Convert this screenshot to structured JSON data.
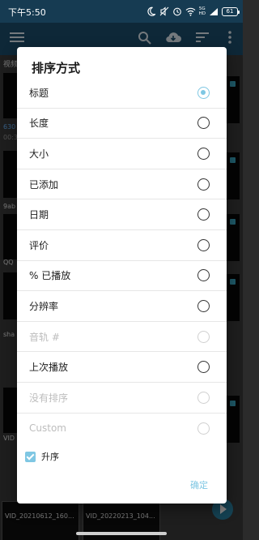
{
  "status_bar": {
    "time": "下午5:50",
    "network": "5G",
    "network_sub": "HD",
    "battery": "61"
  },
  "app_bar": {
    "icons": [
      "menu-icon",
      "search-icon",
      "cloud-download-icon",
      "sort-icon",
      "more-vert-icon"
    ]
  },
  "background": {
    "header": "视频",
    "items": [
      {
        "label": "630",
        "style": "blue"
      },
      {
        "label": "00:3",
        "style": "dim"
      },
      {
        "label": "9ab",
        "style": "normal"
      },
      {
        "label": "QQ",
        "style": "normal"
      },
      {
        "label": "sha",
        "style": "normal"
      },
      {
        "label": "VID",
        "style": "normal"
      }
    ],
    "bottom_captions": [
      "VID_20210612_160...",
      "VID_20220213_104..."
    ]
  },
  "dialog": {
    "title": "排序方式",
    "options": [
      {
        "label": "标题",
        "checked": true,
        "enabled": true
      },
      {
        "label": "长度",
        "checked": false,
        "enabled": true
      },
      {
        "label": "大小",
        "checked": false,
        "enabled": true
      },
      {
        "label": "已添加",
        "checked": false,
        "enabled": true
      },
      {
        "label": "日期",
        "checked": false,
        "enabled": true
      },
      {
        "label": "评价",
        "checked": false,
        "enabled": true
      },
      {
        "label": "% 已播放",
        "checked": false,
        "enabled": true
      },
      {
        "label": "分辨率",
        "checked": false,
        "enabled": true
      },
      {
        "label": "音轨 #",
        "checked": false,
        "enabled": false
      },
      {
        "label": "上次播放",
        "checked": false,
        "enabled": true
      },
      {
        "label": "没有排序",
        "checked": false,
        "enabled": false
      },
      {
        "label": "Custom",
        "checked": false,
        "enabled": false
      }
    ],
    "ascending": {
      "label": "升序",
      "checked": true
    },
    "ok_label": "确定"
  },
  "colors": {
    "accent": "#7fc7e3",
    "status_bar": "#163b52",
    "app_bar": "#1c4d6b"
  }
}
